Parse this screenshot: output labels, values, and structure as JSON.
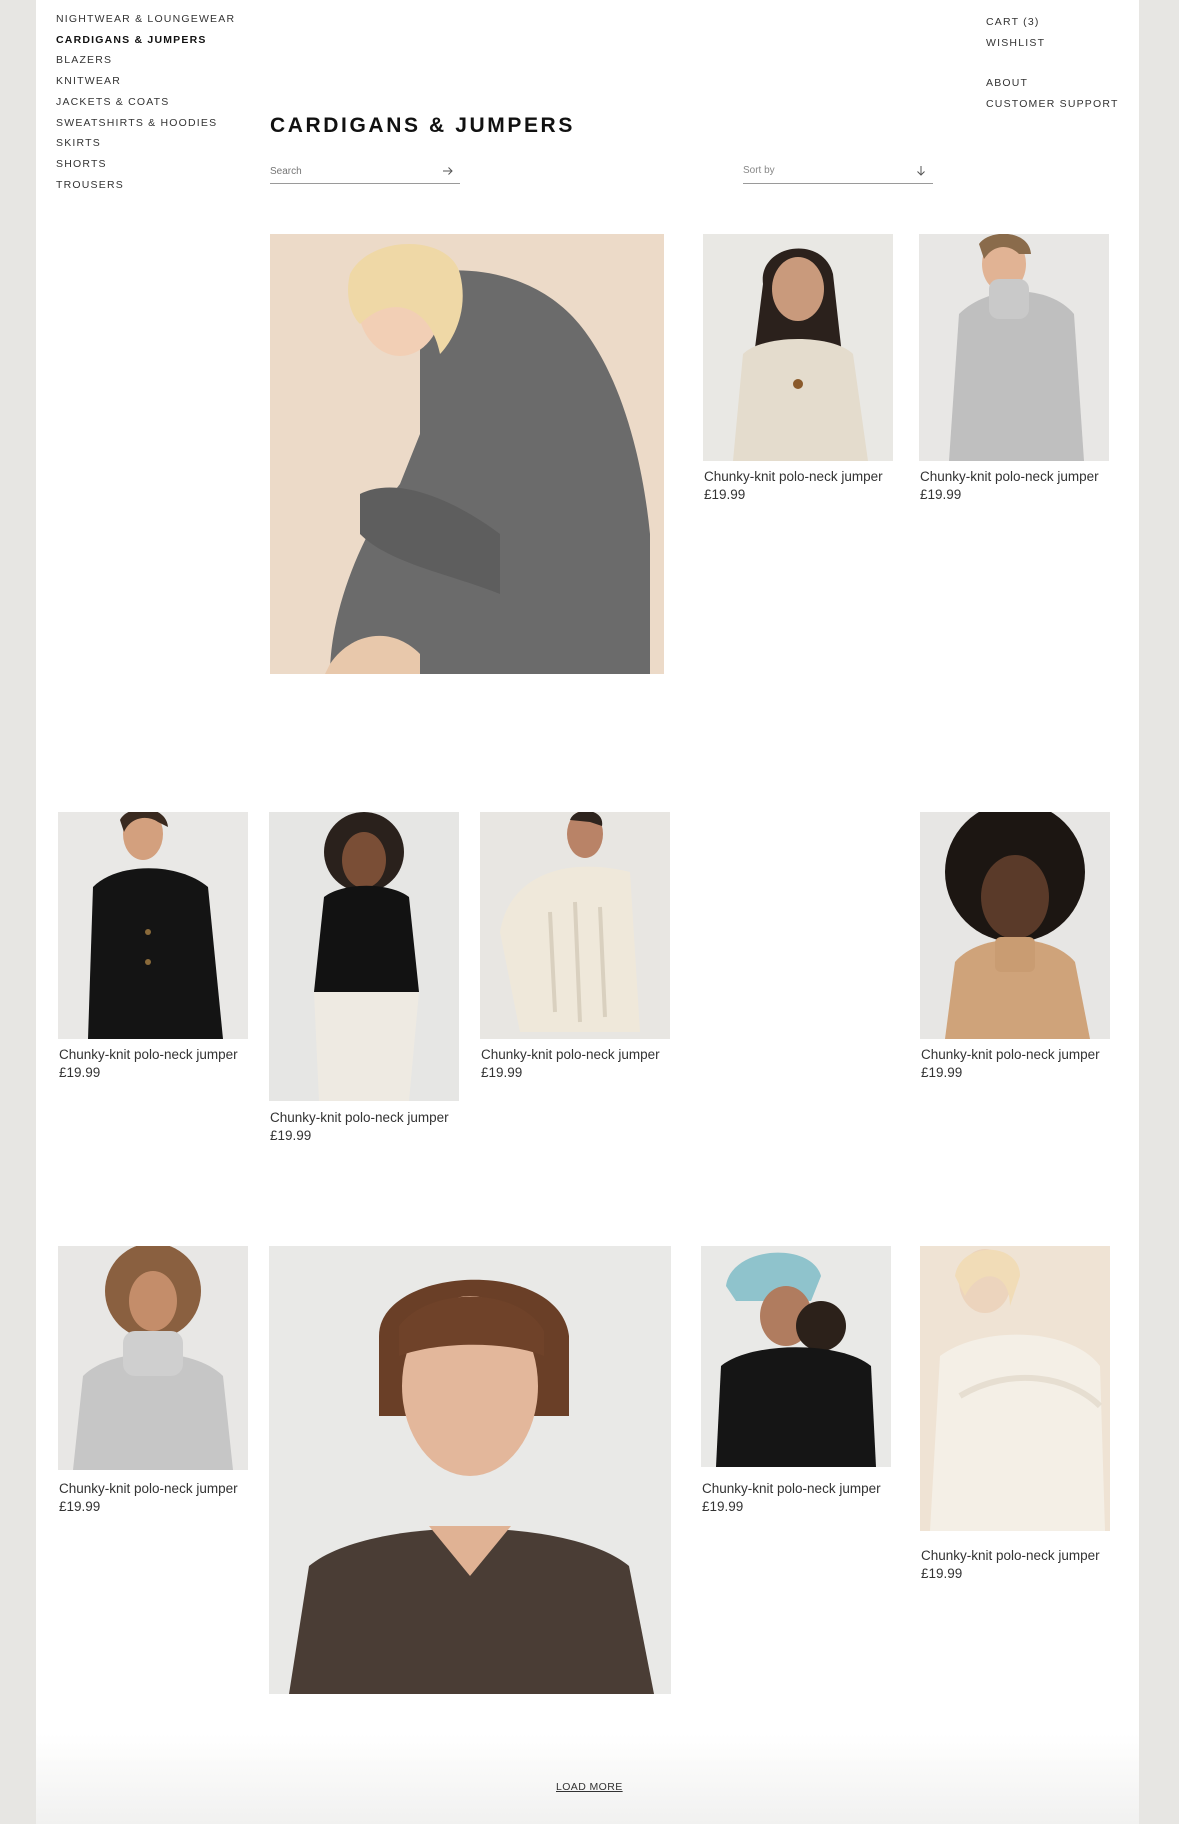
{
  "nav": {
    "categories": [
      "NIGHTWEAR & LOUNGEWEAR",
      "CARDIGANS & JUMPERS",
      "BLAZERS",
      "KNITWEAR",
      "JACKETS & COATS",
      "SWEATSHIRTS & HOODIES",
      "SKIRTS",
      "SHORTS",
      "TROUSERS"
    ],
    "active": "CARDIGANS & JUMPERS"
  },
  "account": {
    "cart": "CART (3)",
    "wishlist": "WISHLIST",
    "about": "ABOUT",
    "support": "CUSTOMER SUPPORT"
  },
  "page_title": "CARDIGANS & JUMPERS",
  "search": {
    "placeholder": "Search"
  },
  "sort": {
    "label": "Sort by"
  },
  "products": [
    {
      "name": "",
      "price": "",
      "photo": "model, grey ribbed knit dress, seated on stool"
    },
    {
      "name": "Chunky-knit polo-neck jumper",
      "price": "£19.99",
      "photo": "cream buttoned cardigan"
    },
    {
      "name": "Chunky-knit polo-neck jumper",
      "price": "£19.99",
      "photo": "grey polo-neck jumper"
    },
    {
      "name": "Chunky-knit polo-neck jumper",
      "price": "£19.99",
      "photo": "black buttoned cardigan"
    },
    {
      "name": "Chunky-knit polo-neck jumper",
      "price": "£19.99",
      "photo": "black zip-neck jumper, white trousers"
    },
    {
      "name": "Chunky-knit polo-neck jumper",
      "price": "£19.99",
      "photo": "cream cable-knit dress"
    },
    {
      "name": "Chunky-knit polo-neck jumper",
      "price": "£19.99",
      "photo": "camel zip-neck jumper"
    },
    {
      "name": "Chunky-knit polo-neck jumper",
      "price": "£19.99",
      "photo": "grey roll-neck jumper"
    },
    {
      "name": "",
      "price": "",
      "photo": "dark brown v-neck ribbed jumper"
    },
    {
      "name": "Chunky-knit polo-neck jumper",
      "price": "£19.99",
      "photo": "black jumper, blue beanie"
    },
    {
      "name": "Chunky-knit polo-neck jumper",
      "price": "£19.99",
      "photo": "white knit set"
    }
  ],
  "load_more": "LOAD MORE",
  "colors": {
    "page_bg": "#e7e6e3",
    "content_bg": "#ffffff",
    "text": "#333333"
  }
}
